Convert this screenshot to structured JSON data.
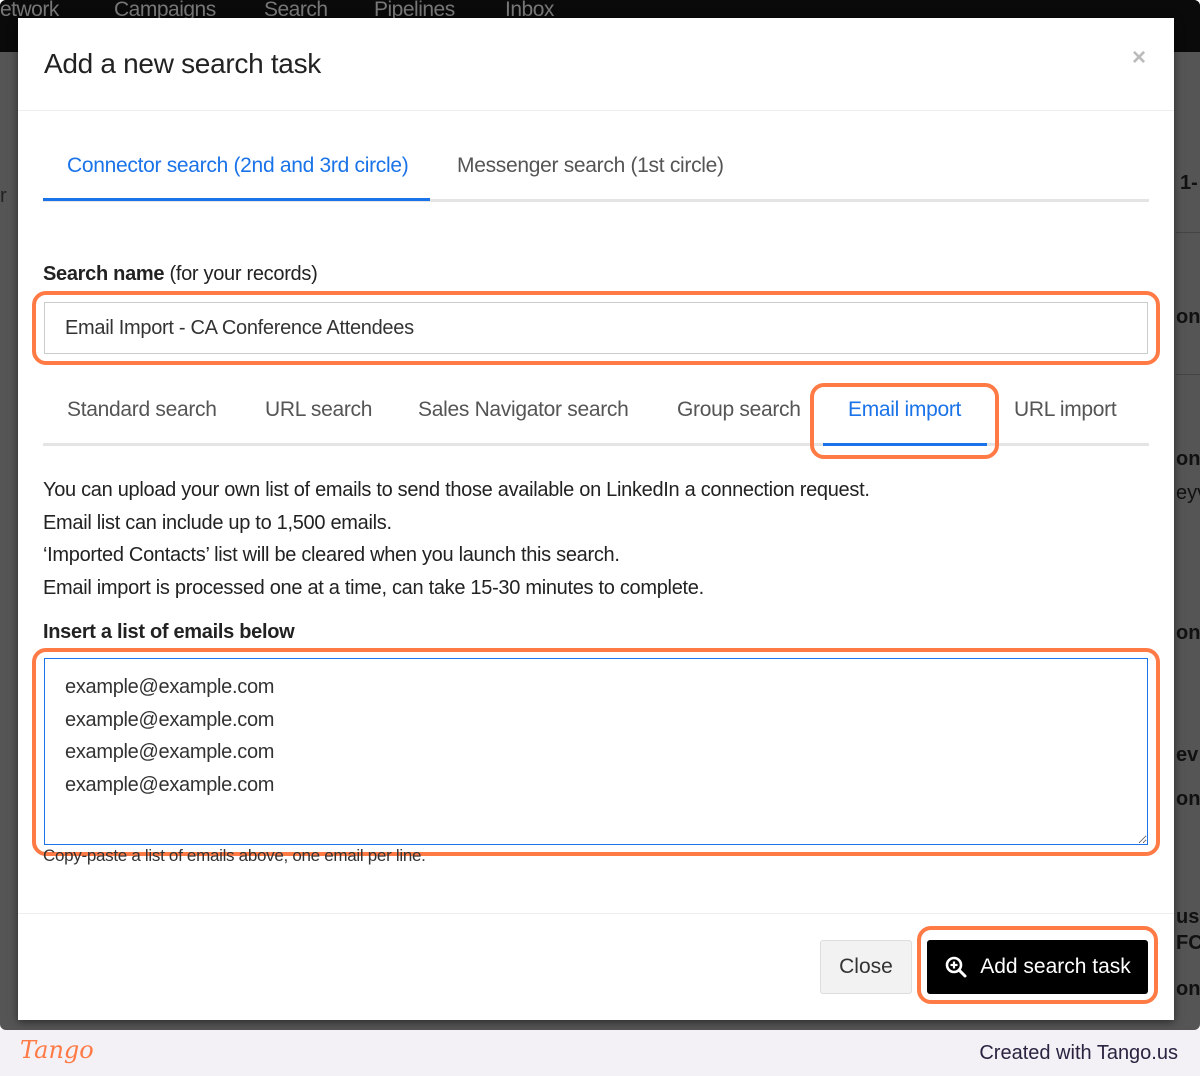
{
  "background": {
    "nav": [
      "etwork",
      "Campaigns",
      "Search",
      "Pipelines",
      "Inbox"
    ],
    "fragments": [
      "r",
      "1-",
      "on",
      "onr",
      "eyv",
      "onr",
      "onr",
      "ev",
      "onr",
      "us",
      "FC",
      "onr"
    ]
  },
  "modal": {
    "title": "Add a new search task",
    "close_icon": "×",
    "tabs": [
      {
        "label": "Connector search (2nd and 3rd circle)",
        "active": true
      },
      {
        "label": "Messenger search (1st circle)",
        "active": false
      }
    ],
    "search_name_label_bold": "Search name",
    "search_name_label_rest": " (for your records)",
    "search_name_value": "Email Import - CA Conference Attendees",
    "subtabs": [
      {
        "label": "Standard search"
      },
      {
        "label": "URL search"
      },
      {
        "label": "Sales Navigator search"
      },
      {
        "label": "Group search"
      },
      {
        "label": "Email import",
        "active": true
      },
      {
        "label": "URL import"
      }
    ],
    "info_lines": [
      "You can upload your own list of emails to send those available on LinkedIn a connection request.",
      "Email list can include up to 1,500 emails.",
      "‘Imported Contacts’ list will be cleared when you launch this search.",
      "Email import is processed one at a time, can take 15-30 minutes to complete."
    ],
    "emails_label": "Insert a list of emails below",
    "emails_value": "example@example.com\nexample@example.com\nexample@example.com\nexample@example.com",
    "help_text": "Copy-paste a list of emails above, one email per line.",
    "close_button": "Close",
    "add_button": "Add search task",
    "add_icon": "search-plus-icon"
  },
  "highlight_color": "#ff7a45",
  "accent_color": "#1a73e8",
  "tango": {
    "logo": "Tango",
    "credit": "Created with Tango.us"
  }
}
